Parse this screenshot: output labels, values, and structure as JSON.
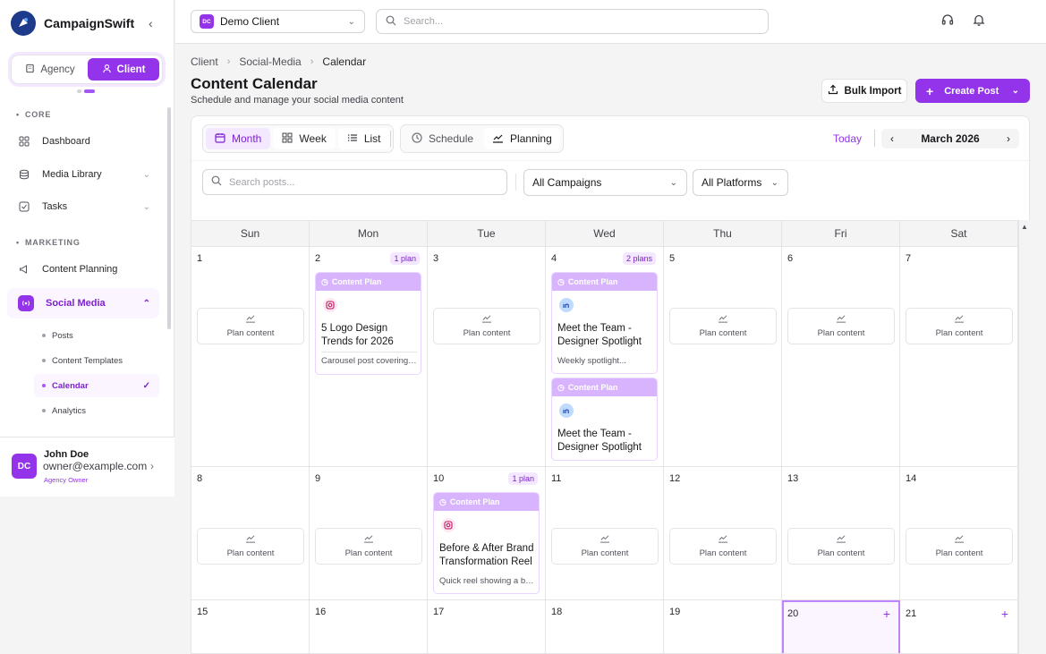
{
  "app": {
    "name": "CampaignSwift"
  },
  "sidebar": {
    "toggle": {
      "agency": "Agency",
      "client": "Client"
    },
    "sections": {
      "core": "CORE",
      "marketing": "MARKETING"
    },
    "items": [
      {
        "label": "Dashboard"
      },
      {
        "label": "Media Library"
      },
      {
        "label": "Tasks"
      },
      {
        "label": "Content Planning"
      },
      {
        "label": "Social Media"
      }
    ],
    "subitems": [
      {
        "label": "Posts"
      },
      {
        "label": "Content Templates"
      },
      {
        "label": "Calendar"
      },
      {
        "label": "Analytics"
      }
    ],
    "user": {
      "initials": "DC",
      "name": "John Doe",
      "email": "owner@example.com",
      "role": "Agency Owner"
    }
  },
  "topbar": {
    "client": {
      "initials": "DC",
      "name": "Demo Client"
    },
    "search_placeholder": "Search..."
  },
  "breadcrumb": [
    "Client",
    "Social-Media",
    "Calendar"
  ],
  "page": {
    "title": "Content Calendar",
    "subtitle": "Schedule and manage your social media content",
    "bulk_import": "Bulk Import",
    "create_post": "Create Post"
  },
  "toolbar": {
    "views": [
      "Month",
      "Week",
      "List"
    ],
    "modes": [
      "Schedule",
      "Planning"
    ],
    "today": "Today",
    "month_label": "March 2026",
    "search_placeholder": "Search posts...",
    "campaign_filter": "All Campaigns",
    "platform_filter": "All Platforms"
  },
  "calendar": {
    "weekdays": [
      "Sun",
      "Mon",
      "Tue",
      "Wed",
      "Thu",
      "Fri",
      "Sat"
    ],
    "plan_label": "Plan content",
    "content_plan_label": "Content Plan",
    "badges": {
      "d2": "1 plan",
      "d4": "2 plans",
      "d10": "1 plan"
    },
    "days_w1": [
      "1",
      "2",
      "3",
      "4",
      "5",
      "6",
      "7"
    ],
    "days_w2": [
      "8",
      "9",
      "10",
      "11",
      "12",
      "13",
      "14"
    ],
    "days_w3": [
      "15",
      "16",
      "17",
      "18",
      "19",
      "20",
      "21"
    ],
    "plans": [
      {
        "day": "2",
        "platform": "instagram",
        "title": "5 Logo Design Trends for 2026",
        "desc": "Carousel post covering the top logo design trends"
      },
      {
        "day": "4",
        "platform": "linkedin",
        "title": "Meet the Team - Designer Spotlight",
        "desc": "Weekly spotlight..."
      },
      {
        "day": "4",
        "platform": "linkedin",
        "title": "Meet the Team - Designer Spotlight",
        "desc": ""
      },
      {
        "day": "10",
        "platform": "instagram",
        "title": "Before & After Brand Transformation Reel",
        "desc": "Quick reel showing a brand transformation"
      }
    ]
  },
  "colors": {
    "accent": "#9333ea",
    "accent_light": "#f3e8ff",
    "plan_header": "#d8b4fe"
  }
}
